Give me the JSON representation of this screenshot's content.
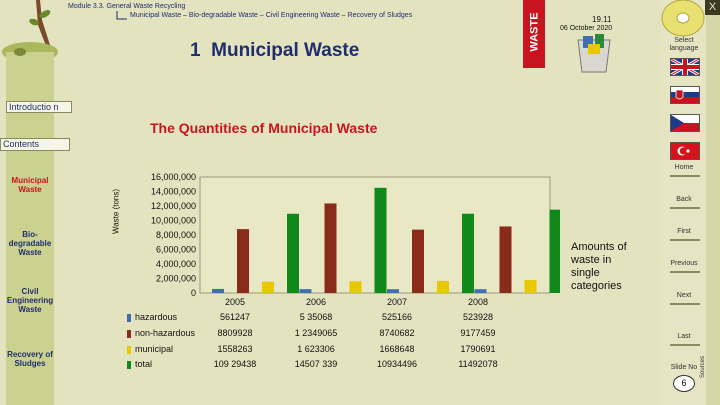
{
  "header": {
    "module_line": "Module 3.3.  General Waste Recycling",
    "crumbs": [
      "Municipal Waste",
      "Bio-degradable Waste",
      "Civil Engineering Waste",
      "Recovery of Sludges"
    ],
    "crumb_sep": "–",
    "section_number": "1",
    "section_title": "Municipal Waste",
    "logo_text": "WASTE",
    "version": "19.11",
    "date": "06 October 2020"
  },
  "sidebar": {
    "tab_intro": "Introductio n",
    "tab_contents": "Contents",
    "items": [
      {
        "label": "Municipal Waste",
        "active": true
      },
      {
        "label": "Bio-degradable Waste",
        "active": false
      },
      {
        "label": "Civil Engineering Waste",
        "active": false
      },
      {
        "label": "Recovery of Sludges",
        "active": false
      }
    ]
  },
  "right_nav": {
    "close_label": "X",
    "select_language": "Select language",
    "flags": [
      "uk-flag",
      "slovakia-flag",
      "czech-flag",
      "turkey-flag"
    ],
    "home": "Home",
    "back": "Back",
    "first": "First",
    "previous": "Previous",
    "next": "Next",
    "last": "Last",
    "slide_no_label": "Slide No",
    "slide_no": "6",
    "sources": "Sources"
  },
  "main": {
    "slide_title": "The Quantities of Municipal Waste",
    "side_note": "Amounts of waste in single categories"
  },
  "chart_data": {
    "type": "bar",
    "ylabel": "Waste (tons)",
    "ylim": [
      0,
      16000000
    ],
    "yticks": [
      "16,000,000",
      "14,000,000",
      "12,000,000",
      "10,000,000",
      "8,000,000",
      "6,000,000",
      "4,000,000",
      "2,000,000",
      "0"
    ],
    "categories": [
      "2005",
      "2006",
      "2007",
      "2008"
    ],
    "series": [
      {
        "name": "hazardous",
        "color": "#3f6fb0",
        "values": [
          561247,
          535068,
          525166,
          523928
        ],
        "display": [
          "561247",
          "5 35068",
          "525166",
          "523928"
        ]
      },
      {
        "name": "non-hazardous",
        "color": "#8a2a1a",
        "values": [
          8809928,
          12349065,
          8740682,
          9177459
        ],
        "display": [
          "8809928",
          "1 2349065",
          "8740682",
          "9177459"
        ]
      },
      {
        "name": "municipal",
        "color": "#e8c800",
        "values": [
          1558263,
          1623306,
          1668648,
          1790691
        ],
        "display": [
          "1558263",
          "1 623306",
          "1668648",
          "1790691"
        ]
      },
      {
        "name": "total",
        "color": "#0f8a1a",
        "values": [
          10929438,
          14507339,
          10934496,
          11492078
        ],
        "display": [
          "109 29438",
          "14507 339",
          "10934496",
          "11492078"
        ]
      }
    ]
  },
  "colors": {
    "title": "#1f2e6c",
    "accent_red": "#c9141f",
    "background": "#e3e3c0"
  }
}
